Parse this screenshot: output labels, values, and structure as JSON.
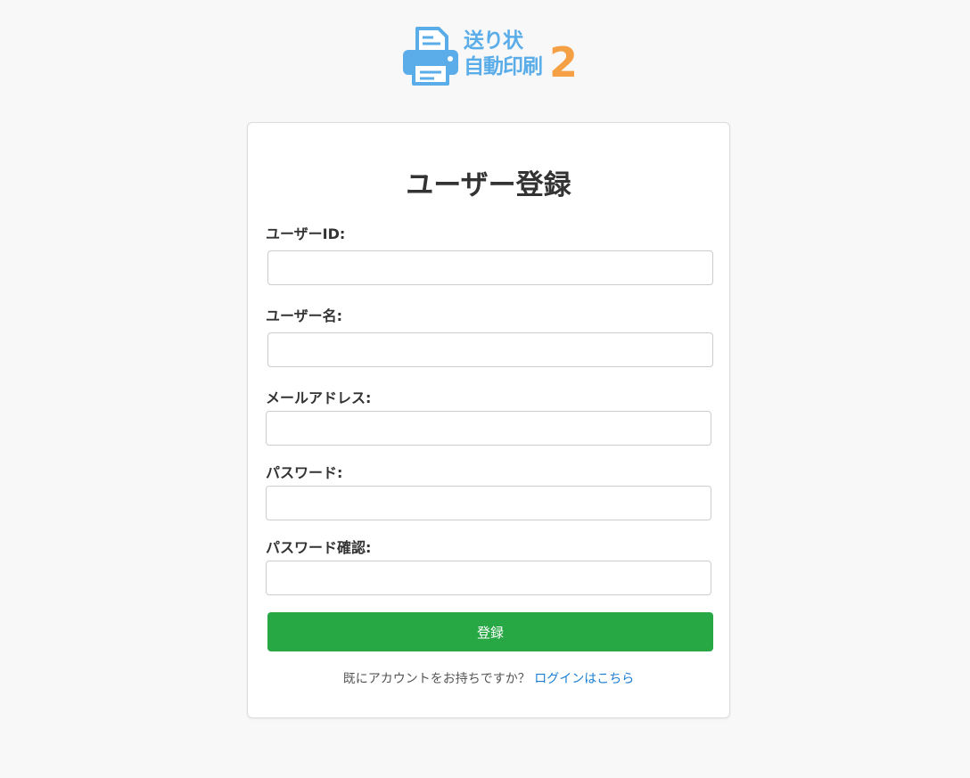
{
  "brand": {
    "line1": "送り状",
    "line2": "自動印刷",
    "version": "2"
  },
  "form": {
    "title": "ユーザー登録",
    "fields": [
      {
        "label": "ユーザーID:",
        "value": "",
        "placeholder": ""
      },
      {
        "label": "ユーザー名:",
        "value": "",
        "placeholder": ""
      },
      {
        "label": "メールアドレス:",
        "value": "",
        "placeholder": ""
      },
      {
        "label": "パスワード:",
        "value": "",
        "placeholder": ""
      },
      {
        "label": "パスワード確認:",
        "value": "",
        "placeholder": ""
      }
    ],
    "submit_label": "登録",
    "login_prompt": "既にアカウントをお持ちですか？",
    "login_link": "ログインはこちら"
  },
  "colors": {
    "background": "#f8f8f8",
    "brand_blue": "#5aade8",
    "brand_orange": "#f5a044",
    "submit_green": "#28a745",
    "link_blue": "#1a7fd4"
  }
}
